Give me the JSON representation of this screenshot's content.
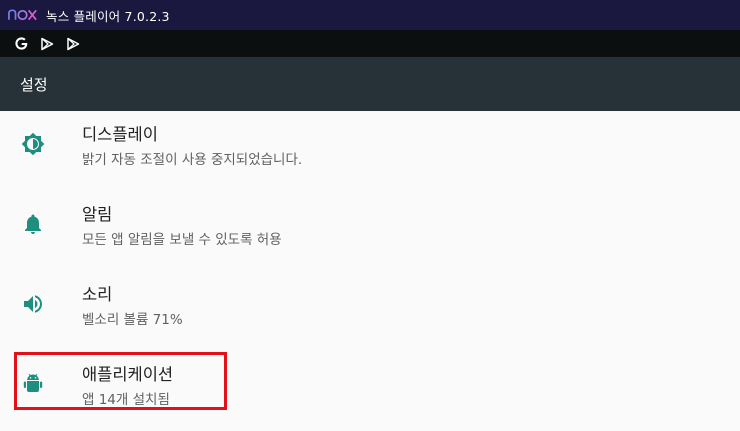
{
  "window": {
    "logo_text": "nox",
    "title": "녹스 플레이어 7.0.2.3"
  },
  "statusbar": {
    "icons": [
      "google-icon",
      "play-store-icon",
      "play-store-icon"
    ]
  },
  "appbar": {
    "title": "설정"
  },
  "settings": [
    {
      "label": "디스플레이",
      "summary": "밝기 자동 조절이 사용 중지되었습니다.",
      "icon": "brightness-icon"
    },
    {
      "label": "알림",
      "summary": "모든 앱 알림을 보낼 수 있도록 허용",
      "icon": "bell-icon"
    },
    {
      "label": "소리",
      "summary": "벨소리 볼륨 71%",
      "icon": "volume-icon"
    },
    {
      "label": "애플리케이션",
      "summary": "앱 14개 설치됨",
      "icon": "android-icon"
    }
  ],
  "colors": {
    "accent": "#1e8e7f",
    "appbar": "#263238",
    "titlebar": "#1b1840",
    "highlight": "#e3101a"
  }
}
